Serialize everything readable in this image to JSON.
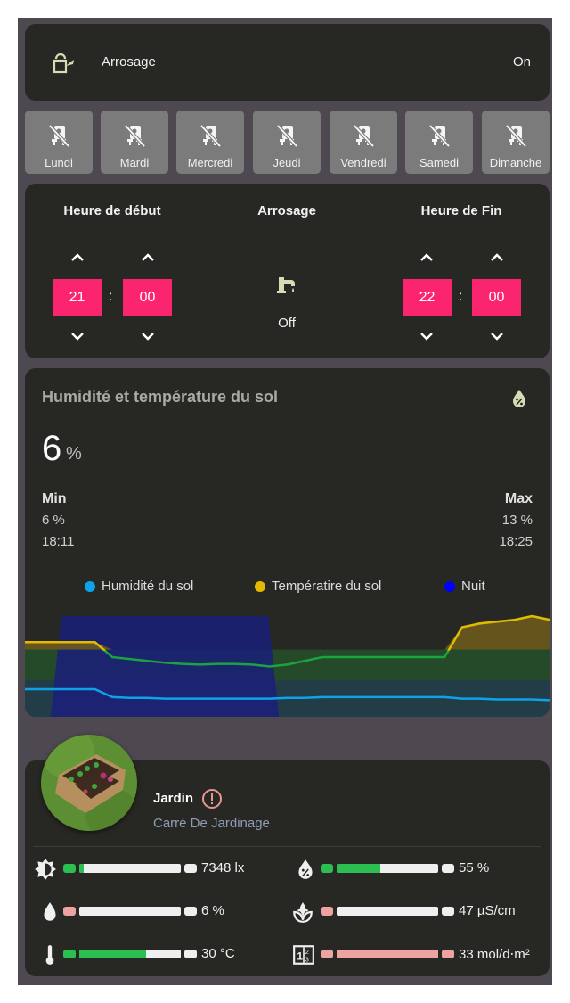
{
  "colors": {
    "background": "#4e4851",
    "card": "#272823",
    "accent_pink": "#fb246f",
    "icon_tint": "#d7dcb4",
    "green": "#2bbf52",
    "pink_bar": "#eea3a3",
    "day_button": "#7b7b7b"
  },
  "toggle": {
    "icon": "watering-can-icon",
    "label": "Arrosage",
    "state": "On"
  },
  "days": [
    {
      "label": "Lundi",
      "icon": "calendar-off-icon"
    },
    {
      "label": "Mardi",
      "icon": "calendar-off-icon"
    },
    {
      "label": "Mercredi",
      "icon": "calendar-off-icon"
    },
    {
      "label": "Jeudi",
      "icon": "calendar-off-icon"
    },
    {
      "label": "Vendredi",
      "icon": "calendar-off-icon"
    },
    {
      "label": "Samedi",
      "icon": "calendar-off-icon"
    },
    {
      "label": "Dimanche",
      "icon": "calendar-off-icon"
    }
  ],
  "timer": {
    "start_title": "Heure de début",
    "center_title": "Arrosage",
    "end_title": "Heure de Fin",
    "start_hour": "21",
    "start_minute": "00",
    "end_hour": "22",
    "end_minute": "00",
    "separator": ":",
    "center_icon": "water-pump-icon",
    "center_state": "Off"
  },
  "sensor": {
    "title": "Humidité et température du sol",
    "icon": "water-percent-icon",
    "value": "6",
    "unit": "%",
    "min_label": "Min",
    "min_value": "6 %",
    "min_time": "18:11",
    "max_label": "Max",
    "max_value": "13 %",
    "max_time": "18:25"
  },
  "chart_data": {
    "type": "line",
    "title": "Humidité et température du sol",
    "legend": [
      {
        "name": "Humidité du sol",
        "color": "#0da2ea"
      },
      {
        "name": "Températire du sol",
        "color": "#e6b800"
      },
      {
        "name": "Nuit",
        "color": "#0000ff"
      }
    ],
    "legend_position": "top",
    "x": [
      0,
      1,
      2,
      3,
      4,
      5,
      6,
      7,
      8,
      9,
      10,
      11,
      12,
      13,
      14,
      15,
      16,
      17,
      18,
      19,
      20,
      21,
      22,
      23,
      24,
      25,
      26,
      27,
      28,
      29,
      30
    ],
    "series": [
      {
        "name": "Humidité du sol",
        "values": [
          13,
          13,
          13,
          13,
          13,
          8,
          7.5,
          7.5,
          7,
          7,
          7,
          7,
          7,
          7,
          7,
          7.5,
          7.5,
          8,
          8,
          8,
          8,
          8,
          8,
          8,
          8,
          7,
          7,
          6.5,
          6.5,
          6.5,
          6
        ]
      },
      {
        "name": "Températire du sol",
        "values": [
          30,
          30,
          30,
          30,
          30,
          26,
          25.5,
          25,
          24.5,
          24.2,
          24,
          24.2,
          24.2,
          24,
          23.5,
          24,
          25,
          26,
          26,
          26,
          26,
          26,
          26,
          26,
          26,
          34,
          35,
          35.5,
          36,
          37,
          36
        ]
      },
      {
        "name": "Nuit",
        "values": [
          0,
          0,
          0,
          1,
          1,
          1,
          1,
          1,
          1,
          1,
          1,
          1,
          1,
          1,
          0,
          0,
          0,
          0,
          0,
          0,
          0,
          0,
          0,
          0,
          0,
          0,
          0,
          0,
          0,
          0,
          0
        ]
      }
    ],
    "grid": false
  },
  "plant": {
    "name": "Jardin",
    "species": "Carré De Jardinage",
    "alert_icon": "alert-circle-icon",
    "sensors": [
      {
        "icon": "brightness-icon",
        "value": "7348 lx",
        "fill": 0.04,
        "status": "ok"
      },
      {
        "icon": "water-percent-icon",
        "value": "55 %",
        "fill": 0.43,
        "status": "ok"
      },
      {
        "icon": "water-drop-icon",
        "value": "6 %",
        "fill": 0.0,
        "status": "low"
      },
      {
        "icon": "sprout-drop-icon",
        "value": "47 µS/cm",
        "fill": 0.0,
        "status": "low"
      },
      {
        "icon": "thermometer-icon",
        "value": "30 °C",
        "fill": 0.66,
        "status": "ok"
      },
      {
        "icon": "counter-icon",
        "value": "33 mol/d⋅m²",
        "fill": 1.0,
        "status": "high"
      }
    ]
  }
}
